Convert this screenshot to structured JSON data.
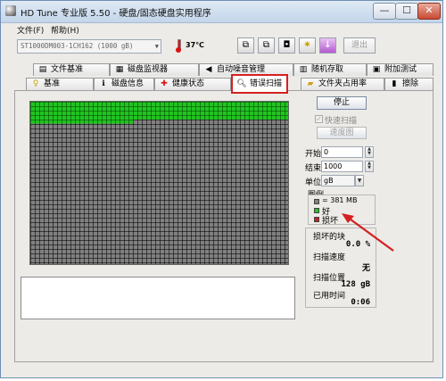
{
  "window": {
    "title": "HD Tune 专业版 5.50 - 硬盘/固态硬盘实用程序",
    "minimize_label": "—",
    "maximize_label": "☐",
    "close_label": "✕"
  },
  "menu": {
    "file": "文件(F)",
    "help": "帮助(H)"
  },
  "toolbar": {
    "drive": "ST1000DM003-1CH162 (1000 gB)",
    "temperature": "37℃",
    "exit_label": "退出"
  },
  "tabs_row1": [
    {
      "label": "文件基准",
      "icon": "doc-icon"
    },
    {
      "label": "磁盘监视器",
      "icon": "monitor-icon"
    },
    {
      "label": "自动噪音管理",
      "icon": "speaker-icon"
    },
    {
      "label": "随机存取",
      "icon": "random-icon"
    },
    {
      "label": "附加测试",
      "icon": "extra-icon"
    }
  ],
  "tabs_row2": [
    {
      "label": "基准",
      "icon": "bulb-icon"
    },
    {
      "label": "磁盘信息",
      "icon": "info-icon"
    },
    {
      "label": "健康状态",
      "icon": "health-icon"
    },
    {
      "label": "错误扫描",
      "icon": "magnifier-icon"
    },
    {
      "label": "文件夹占用率",
      "icon": "folder-icon"
    },
    {
      "label": "擦除",
      "icon": "trash-icon"
    }
  ],
  "scan": {
    "stop_label": "停止",
    "quick_scan_label": "快速扫描",
    "quick_scan_checked": true,
    "speed_map_label": "速度图",
    "start_label": "开始",
    "start_value": "0",
    "end_label": "结束",
    "end_value": "1000",
    "unit_label": "单位",
    "unit_value": "gB"
  },
  "legend": {
    "title": "图例",
    "block_size": "= 381 MB",
    "good_label": "好",
    "bad_label": "损坏",
    "good_color": "#22c422",
    "bad_color": "#c81e1e",
    "block_color": "#808080"
  },
  "stats": {
    "damaged_blocks_label": "损坏的块",
    "damaged_blocks_value": "0.0 %",
    "scan_speed_label": "扫描速度",
    "scan_speed_value": "无",
    "scan_position_label": "扫描位置",
    "scan_position_value": "128 gB",
    "elapsed_label": "已用时间",
    "elapsed_value": "0:06"
  }
}
